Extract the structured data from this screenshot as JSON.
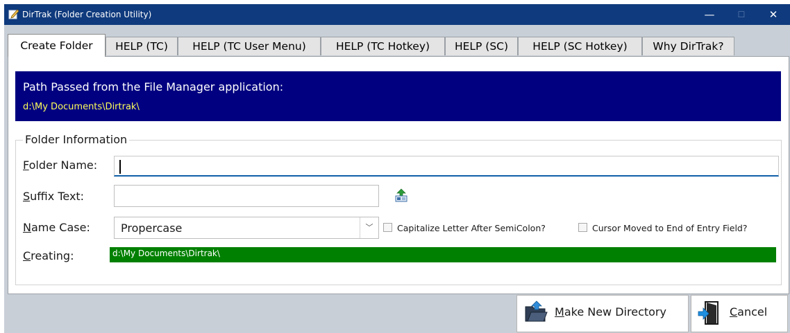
{
  "app": {
    "title": "DirTrak (Folder Creation Utility)",
    "window_controls": {
      "minimize": "—",
      "maximize": "☐",
      "close": "✕"
    }
  },
  "tabs": [
    {
      "label": "Create Folder",
      "active": true
    },
    {
      "label": "HELP (TC)"
    },
    {
      "label": "HELP (TC User Menu)"
    },
    {
      "label": "HELP (TC Hotkey)"
    },
    {
      "label": "HELP (SC)"
    },
    {
      "label": "HELP (SC Hotkey)"
    },
    {
      "label": "Why DirTrak?"
    }
  ],
  "path": {
    "label": "Path Passed from the File Manager application:",
    "value": "d:\\My Documents\\Dirtrak\\"
  },
  "folder_info": {
    "group_title": "Folder Information",
    "folder_name": {
      "label_first": "F",
      "label_rest": "older Name:",
      "value": ""
    },
    "suffix_text": {
      "label_first": "S",
      "label_rest": "uffix Text:",
      "value": ""
    },
    "name_case": {
      "label_first": "N",
      "label_rest": "ame Case:",
      "value": "Propercase"
    },
    "capitalize_checkbox": {
      "label": "Capitalize Letter After SemiColon?",
      "checked": false
    },
    "cursor_checkbox": {
      "label": "Cursor Moved to End of Entry Field?",
      "checked": false
    },
    "creating": {
      "label_first": "C",
      "label_rest": "reating:",
      "value": "d:\\My Documents\\Dirtrak\\"
    }
  },
  "buttons": {
    "make_dir": {
      "label_first": "M",
      "label_rest": "ake New Directory"
    },
    "cancel": {
      "label_first": "C",
      "label_rest": "ancel"
    }
  },
  "colors": {
    "titlebar": "#0f3a7d",
    "path_bg": "#000080",
    "path_value": "#ffff5a",
    "creating_bg": "#008000"
  }
}
